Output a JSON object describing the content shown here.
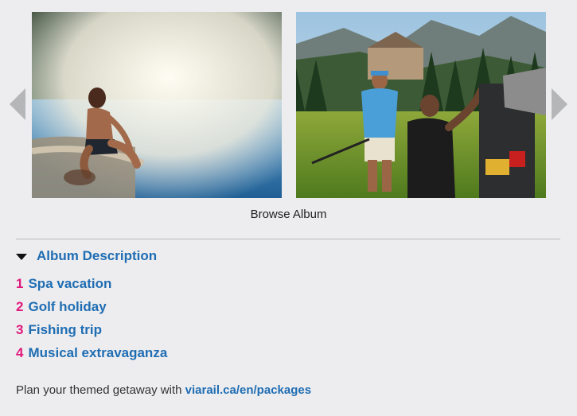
{
  "carousel": {
    "prev_icon": "left-triangle-arrow",
    "next_icon": "right-triangle-arrow",
    "photos": [
      {
        "subject": "spa-hot-spring-photo"
      },
      {
        "subject": "golf-course-photo"
      }
    ],
    "browse_label": "Browse Album"
  },
  "description": {
    "toggle_icon": "triangle-down",
    "title": "Album Description",
    "items": [
      {
        "number": "1",
        "label": "Spa vacation"
      },
      {
        "number": "2",
        "label": "Golf holiday"
      },
      {
        "number": "3",
        "label": "Fishing trip"
      },
      {
        "number": "4",
        "label": "Musical extravaganza"
      }
    ]
  },
  "footer": {
    "text": "Plan your themed getaway with ",
    "link": "viarail.ca/en/packages"
  },
  "colors": {
    "background": "#ededef",
    "link_blue": "#1f6db3",
    "number_pink": "#e0197d",
    "arrow_gray": "#b5b6b8"
  }
}
